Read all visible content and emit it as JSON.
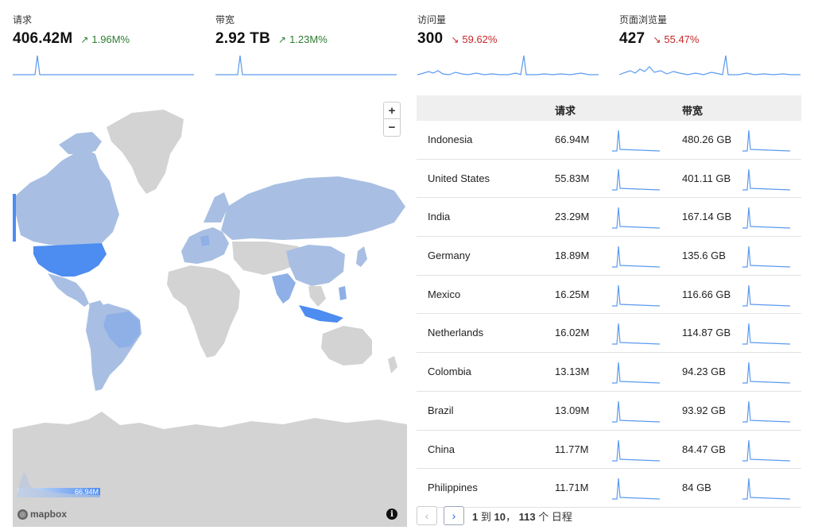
{
  "stats": [
    {
      "label": "请求",
      "value": "406.42M",
      "delta": "1.96M%",
      "trend": "up"
    },
    {
      "label": "带宽",
      "value": "2.92 TB",
      "delta": "1.23M%",
      "trend": "up"
    },
    {
      "label": "访问量",
      "value": "300",
      "delta": "59.62%",
      "trend": "down"
    },
    {
      "label": "页面浏览量",
      "value": "427",
      "delta": "55.47%",
      "trend": "down"
    }
  ],
  "map": {
    "zoom_in": "+",
    "zoom_out": "−",
    "attribution": "mapbox",
    "info": "i",
    "legend_max": "66.94M"
  },
  "table": {
    "col_requests": "请求",
    "col_bandwidth": "带宽",
    "rows": [
      {
        "country": "Indonesia",
        "requests": "66.94M",
        "bandwidth": "480.26 GB"
      },
      {
        "country": "United States",
        "requests": "55.83M",
        "bandwidth": "401.11 GB"
      },
      {
        "country": "India",
        "requests": "23.29M",
        "bandwidth": "167.14 GB"
      },
      {
        "country": "Germany",
        "requests": "18.89M",
        "bandwidth": "135.6 GB"
      },
      {
        "country": "Mexico",
        "requests": "16.25M",
        "bandwidth": "116.66 GB"
      },
      {
        "country": "Netherlands",
        "requests": "16.02M",
        "bandwidth": "114.87 GB"
      },
      {
        "country": "Colombia",
        "requests": "13.13M",
        "bandwidth": "94.23 GB"
      },
      {
        "country": "Brazil",
        "requests": "13.09M",
        "bandwidth": "93.92 GB"
      },
      {
        "country": "China",
        "requests": "11.77M",
        "bandwidth": "84.47 GB"
      },
      {
        "country": "Philippines",
        "requests": "11.71M",
        "bandwidth": "84 GB"
      }
    ]
  },
  "pager": {
    "prev": "‹",
    "next": "›",
    "from": "1",
    "to_word": "到",
    "to": "10",
    "total": "113",
    "unit": "个 日程"
  },
  "colors": {
    "accent": "#4a86e8",
    "spark": "#5b9bef",
    "up": "#2e7d32",
    "down": "#c62828",
    "map_land": "#d3d3d3",
    "map_light": "#a8bfe3",
    "map_dark": "#4d8cf0"
  },
  "icons": {
    "up": "arrow-up-right-icon",
    "down": "arrow-down-right-icon",
    "prev": "chevron-left-icon",
    "next": "chevron-right-icon"
  }
}
